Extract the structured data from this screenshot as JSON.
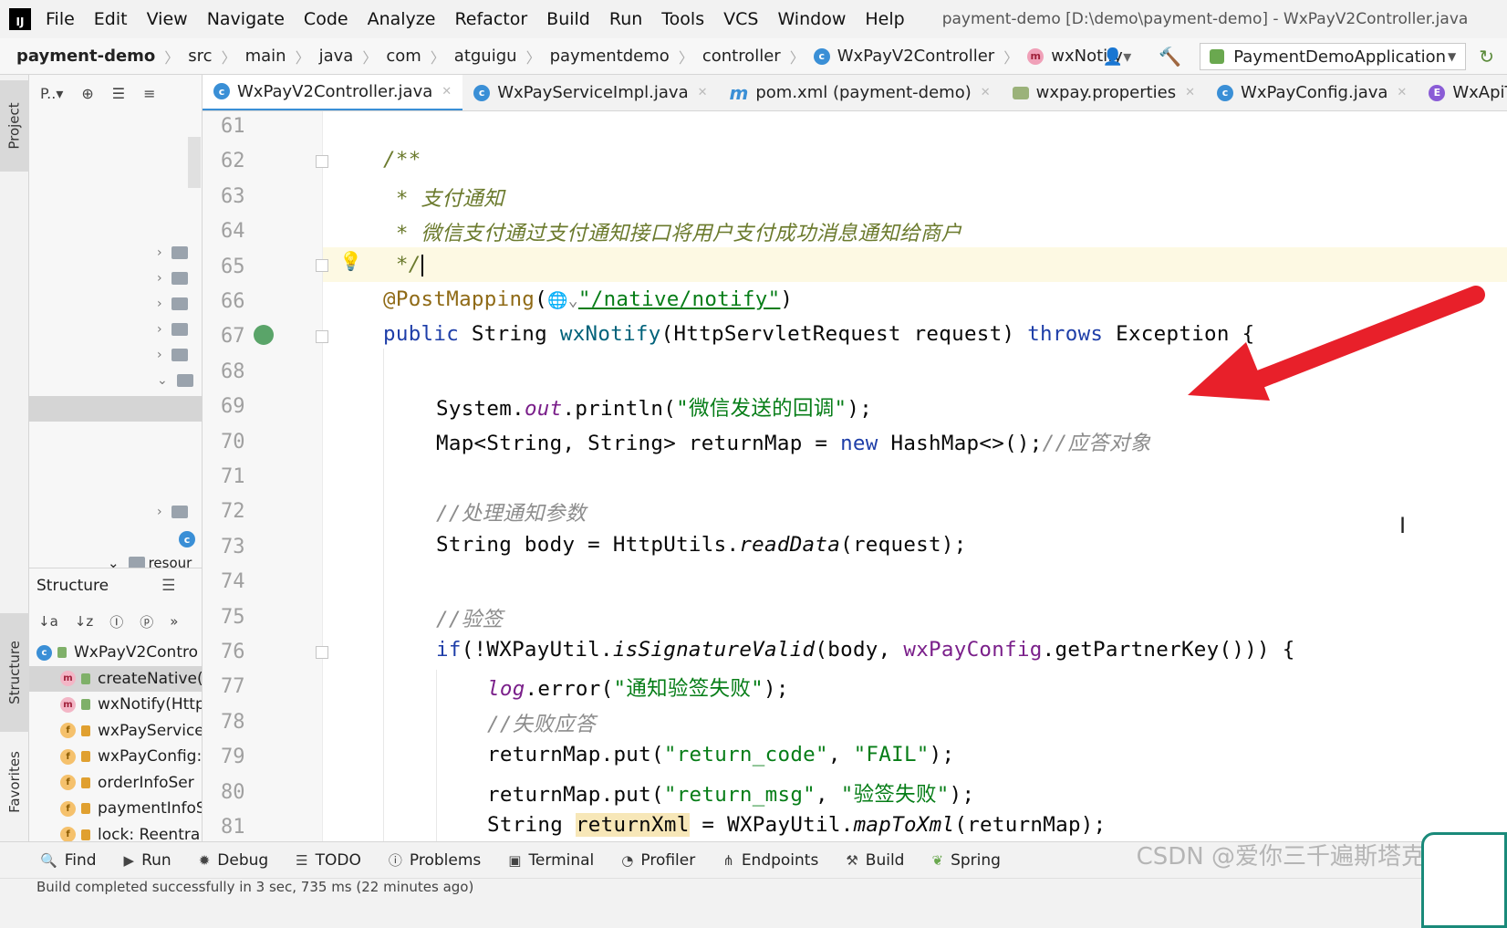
{
  "menubar": {
    "logo": "IJ",
    "items": [
      "File",
      "Edit",
      "View",
      "Navigate",
      "Code",
      "Analyze",
      "Refactor",
      "Build",
      "Run",
      "Tools",
      "VCS",
      "Window",
      "Help"
    ],
    "window_title": "payment-demo [D:\\demo\\payment-demo] - WxPayV2Controller.java"
  },
  "navbar": {
    "crumbs": [
      "payment-demo",
      "src",
      "main",
      "java",
      "com",
      "atguigu",
      "paymentdemo",
      "controller",
      "WxPayV2Controller",
      "wxNotify"
    ],
    "run_config": "PaymentDemoApplication"
  },
  "left_strip": {
    "project_tab": "Project",
    "structure_tab": "Structure",
    "favorites_tab": "Favorites"
  },
  "project_panel": {
    "toolbar_label": "P..▾",
    "partial_row": "resour"
  },
  "structure_panel": {
    "title": "Structure",
    "items": [
      {
        "badge": "c",
        "label": "WxPayV2Contro",
        "lock": "green",
        "root": true
      },
      {
        "badge": "m",
        "label": "createNative(",
        "lock": "green",
        "selected": true
      },
      {
        "badge": "m",
        "label": "wxNotify(Http",
        "lock": "green"
      },
      {
        "badge": "f",
        "label": "wxPayService",
        "lock": "orange"
      },
      {
        "badge": "f",
        "label": "wxPayConfig:",
        "lock": "orange"
      },
      {
        "badge": "f",
        "label": "orderInfoSer",
        "lock": "orange"
      },
      {
        "badge": "f",
        "label": "paymentInfoS",
        "lock": "orange"
      },
      {
        "badge": "f",
        "label": "lock: Reentra",
        "lock": "orange"
      }
    ]
  },
  "tabs": [
    {
      "label": "WxPayV2Controller.java",
      "icon": "c",
      "active": true
    },
    {
      "label": "WxPayServiceImpl.java",
      "icon": "c"
    },
    {
      "label": "pom.xml (payment-demo)",
      "icon": "m"
    },
    {
      "label": "wxpay.properties",
      "icon": "prop"
    },
    {
      "label": "WxPayConfig.java",
      "icon": "c"
    },
    {
      "label": "WxApiTy",
      "icon": "e"
    }
  ],
  "editor": {
    "line_numbers": [
      "61",
      "62",
      "63",
      "64",
      "65",
      "66",
      "67",
      "68",
      "69",
      "70",
      "71",
      "72",
      "73",
      "74",
      "75",
      "76",
      "77",
      "78",
      "79",
      "80",
      "81"
    ],
    "doc_start": "/**",
    "doc_line1": " * 支付通知",
    "doc_line2": " * 微信支付通过支付通知接口将用户支付成功消息通知给商户",
    "doc_end": " */",
    "annotation": "@PostMapping",
    "mapping_path": "\"/native/notify\"",
    "sig_public": "public",
    "sig_string": " String ",
    "sig_method": "wxNotify",
    "sig_params": "(HttpServletRequest request) ",
    "sig_throws": "throws",
    "sig_exc": " Exception {",
    "l69_a": "System.",
    "l69_out": "out",
    "l69_b": ".println(",
    "l69_str": "\"微信发送的回调\"",
    "l69_c": ");",
    "l70_a": "Map<String, String> returnMap = ",
    "l70_new": "new",
    "l70_b": " HashMap<>();",
    "l70_cmt": "//应答对象",
    "l72_cmt": "//处理通知参数",
    "l73_a": "String body = HttpUtils.",
    "l73_m": "readData",
    "l73_b": "(request);",
    "l75_cmt": "//验签",
    "l76_if": "if",
    "l76_a": "(!WXPayUtil.",
    "l76_m": "isSignatureValid",
    "l76_b": "(body, ",
    "l76_fld": "wxPayConfig",
    "l76_c": ".getPartnerKey())) {",
    "l77_log": "log",
    "l77_a": ".error(",
    "l77_str": "\"通知验签失败\"",
    "l77_b": ");",
    "l78_cmt": "//失败应答",
    "l79_a": "returnMap.put(",
    "l79_s1": "\"return_code\"",
    "l79_b": ", ",
    "l79_s2": "\"FAIL\"",
    "l79_c": ");",
    "l80_a": "returnMap.put(",
    "l80_s1": "\"return_msg\"",
    "l80_b": ", ",
    "l80_s2": "\"验签失败\"",
    "l80_c": ");",
    "l81_a": "String ",
    "l81_var": "returnXml",
    "l81_b": " = WXPayUtil.",
    "l81_m": "mapToXml",
    "l81_c": "(returnMap);"
  },
  "tool_windows": [
    "Find",
    "Run",
    "Debug",
    "TODO",
    "Problems",
    "Terminal",
    "Profiler",
    "Endpoints",
    "Build",
    "Spring"
  ],
  "status": {
    "text": "Build completed successfully in 3 sec, 735 ms (22 minutes ago)"
  },
  "watermark": "CSDN @爱你三千遍斯塔克",
  "colors": {
    "arrow": "#e8202a",
    "accent": "#3a8fd6"
  }
}
